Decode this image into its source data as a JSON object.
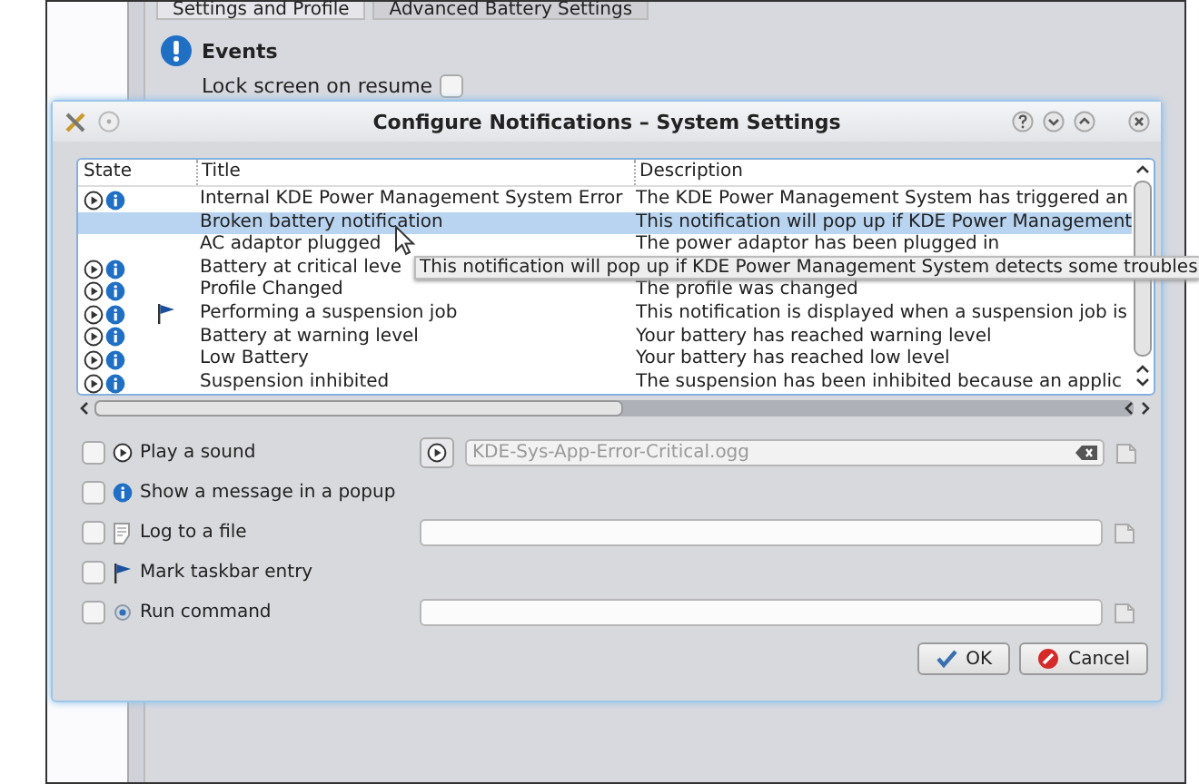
{
  "background_window": {
    "tabs": [
      {
        "label": "Settings and Profile",
        "selected": true
      },
      {
        "label": "Advanced Battery Settings",
        "selected": false
      }
    ],
    "section_title": "Events",
    "options": [
      {
        "label": "Lock screen on resume",
        "checked": false
      }
    ]
  },
  "dialog": {
    "title": "Configure Notifications – System Settings"
  },
  "table": {
    "columns": [
      "State",
      "Title",
      "Description"
    ],
    "rows": [
      {
        "title": "Internal KDE Power Management System Error",
        "description": "The KDE Power Management System has triggered an",
        "sound": true,
        "popup": true,
        "taskbar": false,
        "selected": false
      },
      {
        "title": "Broken battery notification",
        "description": "This notification will pop up if KDE Power Management",
        "sound": false,
        "popup": false,
        "taskbar": false,
        "selected": true
      },
      {
        "title": "AC adaptor plugged",
        "description": "The power adaptor has been plugged in",
        "sound": false,
        "popup": false,
        "taskbar": false,
        "selected": false
      },
      {
        "title": "Battery at critical leve",
        "sound": true,
        "popup": true,
        "taskbar": false,
        "selected": false
      },
      {
        "title": "Profile Changed",
        "description": "The profile was changed",
        "sound": true,
        "popup": true,
        "taskbar": false,
        "selected": false
      },
      {
        "title": "Performing a suspension job",
        "description": "This notification is displayed when a suspension job is",
        "sound": true,
        "popup": true,
        "taskbar": true,
        "selected": false
      },
      {
        "title": "Battery at warning level",
        "description": "Your battery has reached warning level",
        "sound": true,
        "popup": true,
        "taskbar": false,
        "selected": false
      },
      {
        "title": "Low Battery",
        "description": "Your battery has reached low level",
        "sound": true,
        "popup": true,
        "taskbar": false,
        "selected": false
      },
      {
        "title": "Suspension inhibited",
        "description": "The suspension has been inhibited because an applic",
        "sound": true,
        "popup": true,
        "taskbar": false,
        "selected": false
      }
    ]
  },
  "tooltip": "This notification will pop up if KDE Power Management System detects some troubles",
  "actions": [
    {
      "kind": "sound",
      "label": "Play a sound",
      "checked": false,
      "value": "KDE-Sys-App-Error-Critical.ogg"
    },
    {
      "kind": "popup",
      "label": "Show a message in a popup",
      "checked": false
    },
    {
      "kind": "log",
      "label": "Log to a file",
      "checked": false
    },
    {
      "kind": "taskbar",
      "label": "Mark taskbar entry",
      "checked": false
    },
    {
      "kind": "command",
      "label": "Run command",
      "checked": false
    }
  ],
  "buttons": [
    {
      "kind": "ok",
      "label": "OK"
    },
    {
      "kind": "cancel",
      "label": "Cancel"
    }
  ]
}
